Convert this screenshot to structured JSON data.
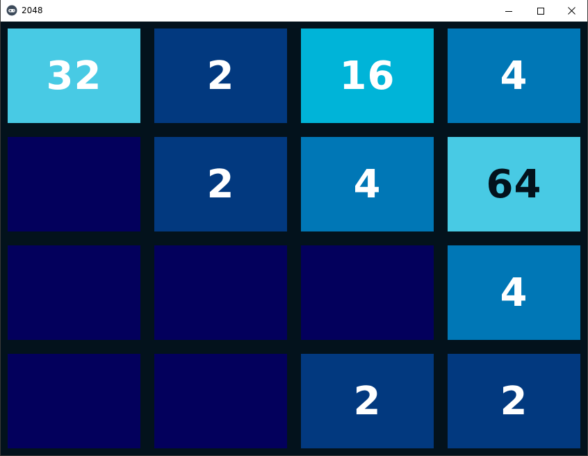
{
  "window": {
    "title": "2048",
    "icon": "gamepad-icon",
    "controls": {
      "minimize": "minimize-icon",
      "maximize": "maximize-icon",
      "close": "close-icon"
    }
  },
  "colors": {
    "board_background": "#03121c",
    "empty": "#03005c",
    "t2": "#02397f",
    "t4": "#0077b6",
    "t16": "#00b4d8",
    "t32": "#48cae4",
    "t64": "#48cae4",
    "text_light": "#ffffff",
    "text_dark": "#03121c"
  },
  "board": {
    "rows": [
      [
        {
          "value": "32",
          "bg": "#48cae4",
          "fg": "#ffffff"
        },
        {
          "value": "2",
          "bg": "#02397f",
          "fg": "#ffffff"
        },
        {
          "value": "16",
          "bg": "#00b4d8",
          "fg": "#ffffff"
        },
        {
          "value": "4",
          "bg": "#0077b6",
          "fg": "#ffffff"
        }
      ],
      [
        {
          "value": "",
          "bg": "#03005c",
          "fg": "#ffffff"
        },
        {
          "value": "2",
          "bg": "#02397f",
          "fg": "#ffffff"
        },
        {
          "value": "4",
          "bg": "#0077b6",
          "fg": "#ffffff"
        },
        {
          "value": "64",
          "bg": "#48cae4",
          "fg": "#03121c"
        }
      ],
      [
        {
          "value": "",
          "bg": "#03005c",
          "fg": "#ffffff"
        },
        {
          "value": "",
          "bg": "#03005c",
          "fg": "#ffffff"
        },
        {
          "value": "",
          "bg": "#03005c",
          "fg": "#ffffff"
        },
        {
          "value": "4",
          "bg": "#0077b6",
          "fg": "#ffffff"
        }
      ],
      [
        {
          "value": "",
          "bg": "#03005c",
          "fg": "#ffffff"
        },
        {
          "value": "",
          "bg": "#03005c",
          "fg": "#ffffff"
        },
        {
          "value": "2",
          "bg": "#02397f",
          "fg": "#ffffff"
        },
        {
          "value": "2",
          "bg": "#02397f",
          "fg": "#ffffff"
        }
      ]
    ]
  }
}
